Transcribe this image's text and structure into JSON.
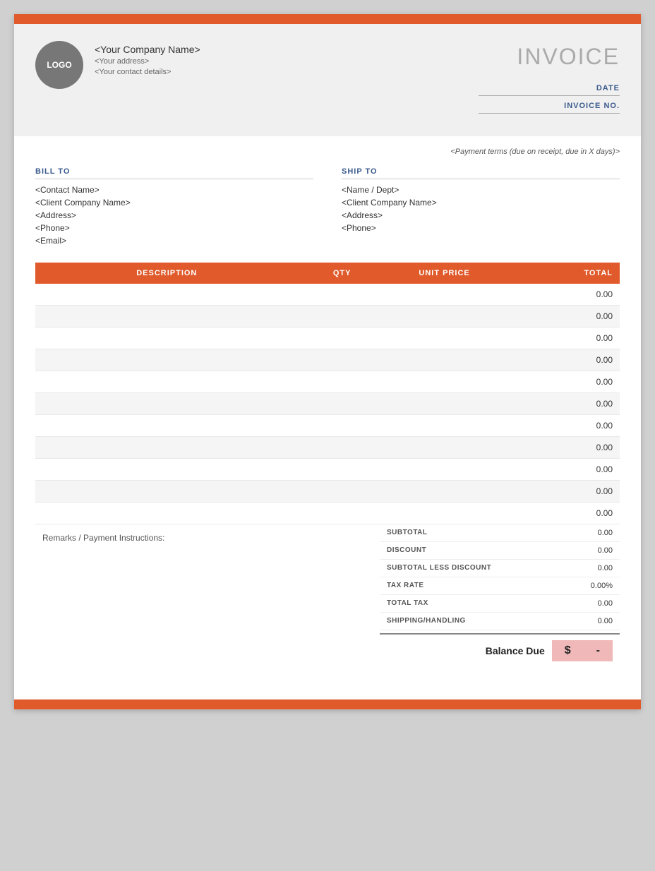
{
  "topBar": {
    "color": "#e05a2b"
  },
  "header": {
    "logo": "LOGO",
    "companyName": "<Your Company Name>",
    "companyAddress": "<Your address>",
    "companyContact": "<Your contact details>",
    "invoiceTitle": "INVOICE",
    "dateLabel": "DATE",
    "invoiceNoLabel": "INVOICE NO."
  },
  "body": {
    "paymentTerms": "<Payment terms (due on receipt, due in X days)>",
    "billTo": {
      "label": "BILL TO",
      "contactName": "<Contact Name>",
      "clientCompany": "<Client Company Name>",
      "address": "<Address>",
      "phone": "<Phone>",
      "email": "<Email>"
    },
    "shipTo": {
      "label": "SHIP TO",
      "nameDept": "<Name / Dept>",
      "clientCompany": "<Client Company Name>",
      "address": "<Address>",
      "phone": "<Phone>"
    }
  },
  "table": {
    "headers": [
      "DESCRIPTION",
      "QTY",
      "UNIT PRICE",
      "TOTAL"
    ],
    "rows": [
      {
        "description": "",
        "qty": "",
        "unitPrice": "",
        "total": "0.00"
      },
      {
        "description": "",
        "qty": "",
        "unitPrice": "",
        "total": "0.00"
      },
      {
        "description": "",
        "qty": "",
        "unitPrice": "",
        "total": "0.00"
      },
      {
        "description": "",
        "qty": "",
        "unitPrice": "",
        "total": "0.00"
      },
      {
        "description": "",
        "qty": "",
        "unitPrice": "",
        "total": "0.00"
      },
      {
        "description": "",
        "qty": "",
        "unitPrice": "",
        "total": "0.00"
      },
      {
        "description": "",
        "qty": "",
        "unitPrice": "",
        "total": "0.00"
      },
      {
        "description": "",
        "qty": "",
        "unitPrice": "",
        "total": "0.00"
      },
      {
        "description": "",
        "qty": "",
        "unitPrice": "",
        "total": "0.00"
      },
      {
        "description": "",
        "qty": "",
        "unitPrice": "",
        "total": "0.00"
      },
      {
        "description": "",
        "qty": "",
        "unitPrice": "",
        "total": "0.00"
      }
    ]
  },
  "totals": {
    "remarksLabel": "Remarks / Payment Instructions:",
    "subtotalLabel": "SUBTOTAL",
    "subtotalValue": "0.00",
    "discountLabel": "DISCOUNT",
    "discountValue": "0.00",
    "subtotalLessDiscountLabel": "SUBTOTAL LESS DISCOUNT",
    "subtotalLessDiscountValue": "0.00",
    "taxRateLabel": "TAX RATE",
    "taxRateValue": "0.00%",
    "totalTaxLabel": "TOTAL TAX",
    "totalTaxValue": "0.00",
    "shippingHandlingLabel": "SHIPPING/HANDLING",
    "shippingHandlingValue": "0.00",
    "balanceDueLabel": "Balance Due",
    "balanceDueCurrency": "$",
    "balanceDueValue": "-"
  }
}
